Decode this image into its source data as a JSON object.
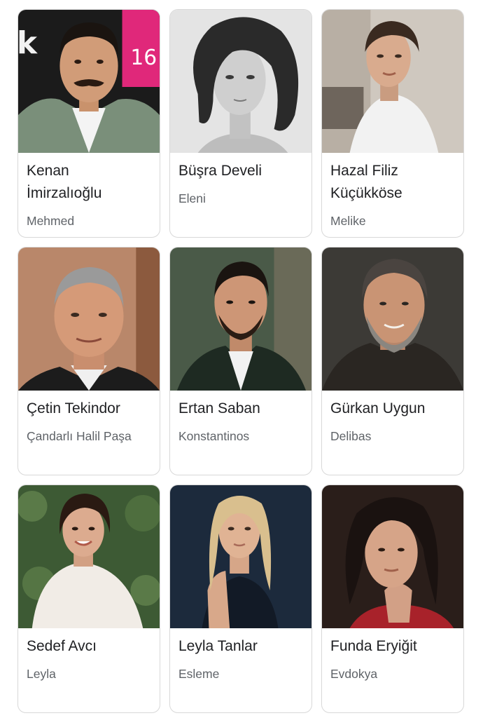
{
  "cast": [
    {
      "name": "Kenan İmirzalıoğlu",
      "name_line1": "Kenan",
      "name_line2": "İmirzalıoğlu",
      "role": "Mehmed"
    },
    {
      "name": "Büşra Develi",
      "role": "Eleni"
    },
    {
      "name": "Hazal Filiz Küçükköse",
      "name_line1": "Hazal Filiz",
      "name_line2": "Küçükköse",
      "role": "Melike"
    },
    {
      "name": "Çetin Tekindor",
      "role": "Çandarlı Halil Paşa"
    },
    {
      "name": "Ertan Saban",
      "role": "Konstantinos"
    },
    {
      "name": "Gürkan Uygun",
      "role": "Delibas"
    },
    {
      "name": "Sedef Avcı",
      "role": "Leyla"
    },
    {
      "name": "Leyla Tanlar",
      "role": "Esleme"
    },
    {
      "name": "Funda Eryiğit",
      "role": "Evdokya"
    }
  ],
  "backdrop_text": {
    "letter": "k",
    "sign": "16"
  }
}
